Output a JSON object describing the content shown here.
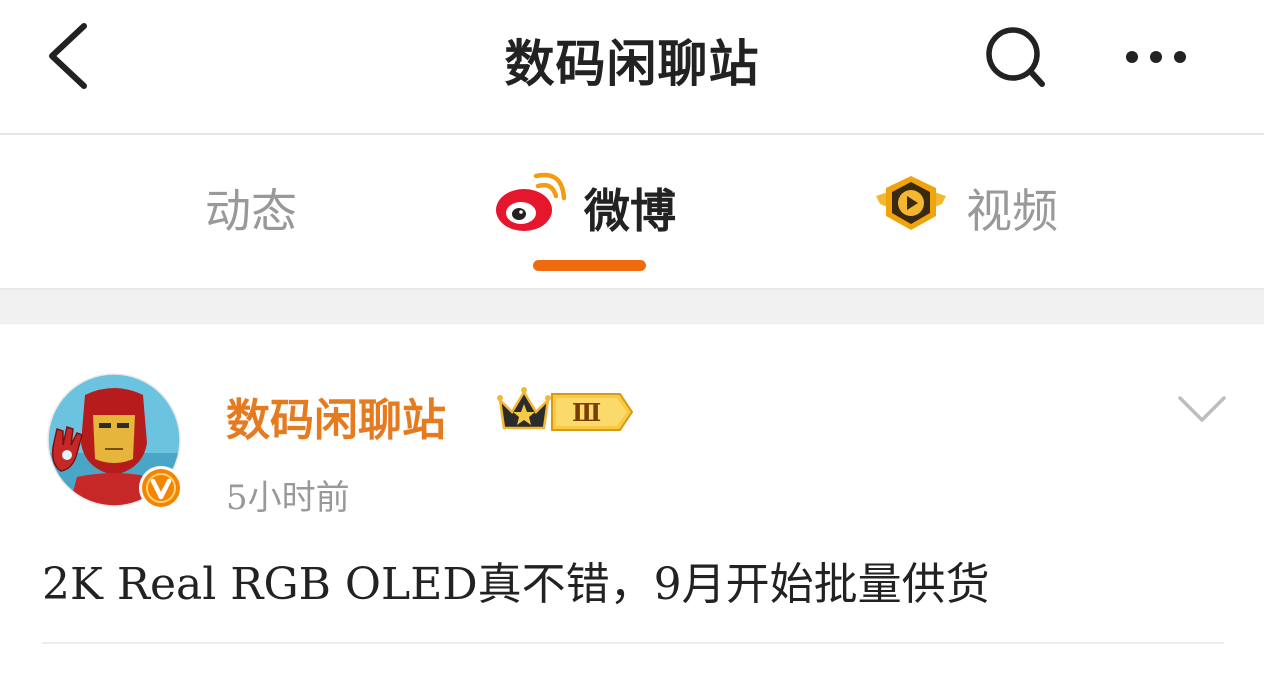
{
  "header": {
    "title": "数码闲聊站",
    "back_icon": "chevron-left-icon",
    "search_icon": "search-icon",
    "more_icon": "more-dots-icon"
  },
  "tabs": [
    {
      "label": "动态",
      "active": false
    },
    {
      "label": "微博",
      "active": true,
      "icon": "weibo-logo-icon"
    },
    {
      "label": "视频",
      "active": false,
      "icon": "video-badge-icon"
    }
  ],
  "post": {
    "author": "数码闲聊站",
    "vip_level": "Ⅲ",
    "time": "5小时前",
    "text": "2K Real RGB OLED真不错，9月开始批量供货"
  },
  "colors": {
    "accent": "#ee6b10",
    "author_name": "#e67a1e",
    "text_primary": "#222222",
    "text_secondary": "#999999"
  }
}
